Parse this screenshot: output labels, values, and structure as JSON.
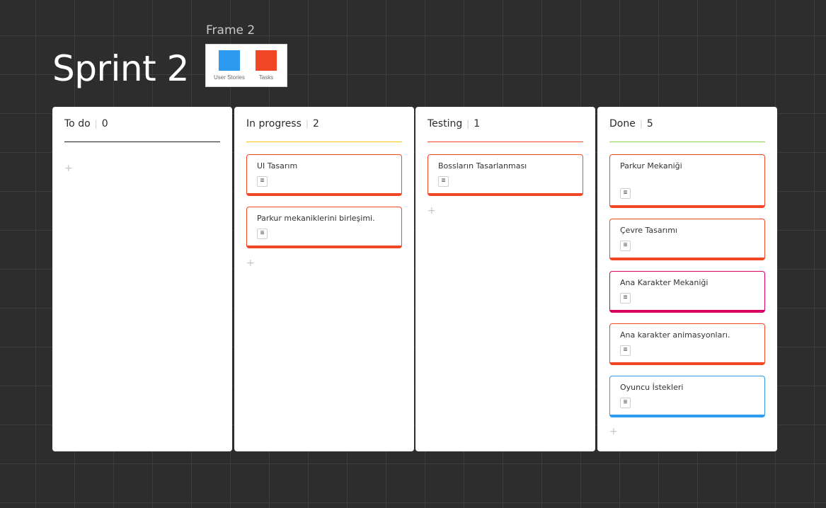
{
  "board": {
    "title": "Sprint 2"
  },
  "frame": {
    "label": "Frame 2",
    "legend": [
      {
        "label": "User Stories",
        "color": "#2d9bf0"
      },
      {
        "label": "Tasks",
        "color": "#f24726"
      }
    ]
  },
  "columns": [
    {
      "title": "To do",
      "separator": "|",
      "count": "0",
      "line_color": "#1a1a1a",
      "add_icon": "+",
      "cards": []
    },
    {
      "title": "In progress",
      "separator": "|",
      "count": "2",
      "line_color": "#fac710",
      "add_icon": "+",
      "cards": [
        {
          "title": "UI Tasarım",
          "color": "#f24726",
          "icon": "description-icon"
        },
        {
          "title": "Parkur mekaniklerini birleşimi.",
          "color": "#f24726",
          "icon": "description-icon"
        }
      ]
    },
    {
      "title": "Testing",
      "separator": "|",
      "count": "1",
      "line_color": "#f24726",
      "add_icon": "+",
      "cards": [
        {
          "title": "Bossların Tasarlanması",
          "color": "#f24726",
          "icon": "description-icon"
        }
      ]
    },
    {
      "title": "Done",
      "separator": "|",
      "count": "5",
      "line_color": "#8fd14f",
      "add_icon": "+",
      "cards": [
        {
          "title": "Parkur Mekaniği",
          "color": "#f24726",
          "icon": "description-icon"
        },
        {
          "title": "Çevre Tasarımı",
          "color": "#f24726",
          "icon": "description-icon"
        },
        {
          "title": "Ana Karakter Mekaniği",
          "color": "#da0063",
          "icon": "description-icon"
        },
        {
          "title": "Ana karakter animasyonları.",
          "color": "#f24726",
          "icon": "description-icon"
        },
        {
          "title": "Oyuncu İstekleri",
          "color": "#2d9bf0",
          "icon": "description-icon"
        }
      ]
    }
  ]
}
